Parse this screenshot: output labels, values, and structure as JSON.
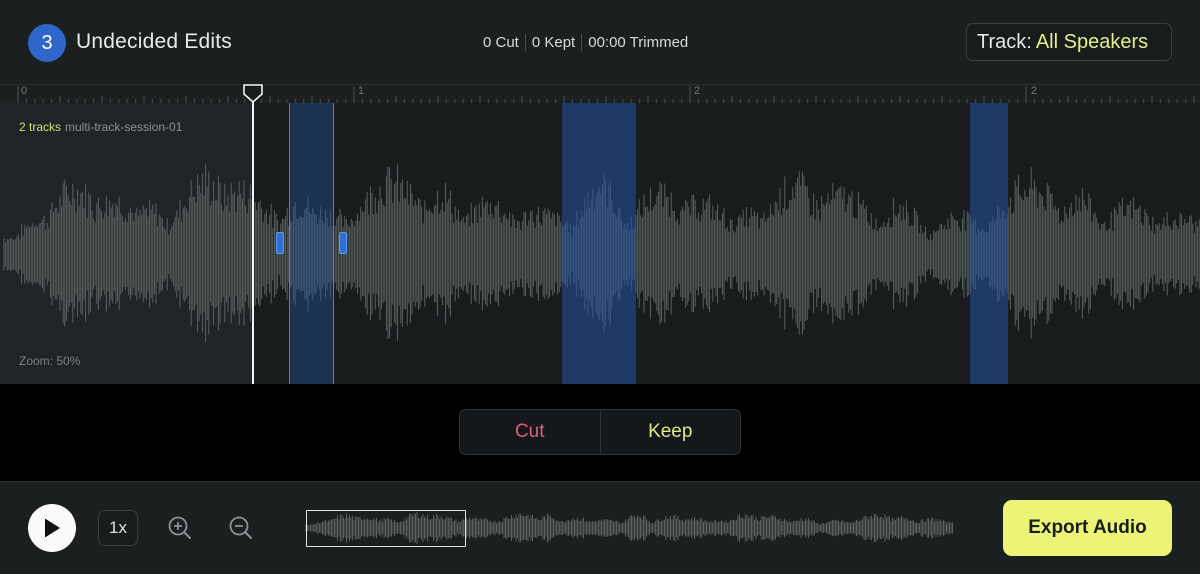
{
  "header": {
    "undecided_count": "3",
    "title": "Undecided Edits",
    "stats": {
      "cut": "0 Cut",
      "kept": "0 Kept",
      "trimmed": "00:00 Trimmed"
    },
    "track_label": "Track:",
    "track_value": "All Speakers"
  },
  "ruler": {
    "labels": [
      "0",
      "1",
      "2",
      "2"
    ]
  },
  "editor": {
    "track_count": "2 tracks",
    "session_name": "multi-track-session-01",
    "zoom_text": "Zoom: 50%"
  },
  "decision": {
    "cut_label": "Cut",
    "keep_label": "Keep"
  },
  "footer": {
    "speed": "1x",
    "export_label": "Export Audio"
  },
  "colors": {
    "accent_yellow": "#ecf477",
    "cut_red": "#e0607a",
    "badge_blue": "#2e67c9",
    "region_blue": "#2452a0"
  },
  "icons": {
    "play": "play-icon",
    "zoom_in": "zoom-in-icon",
    "zoom_out": "zoom-out-icon",
    "playhead": "playhead-marker-icon"
  }
}
